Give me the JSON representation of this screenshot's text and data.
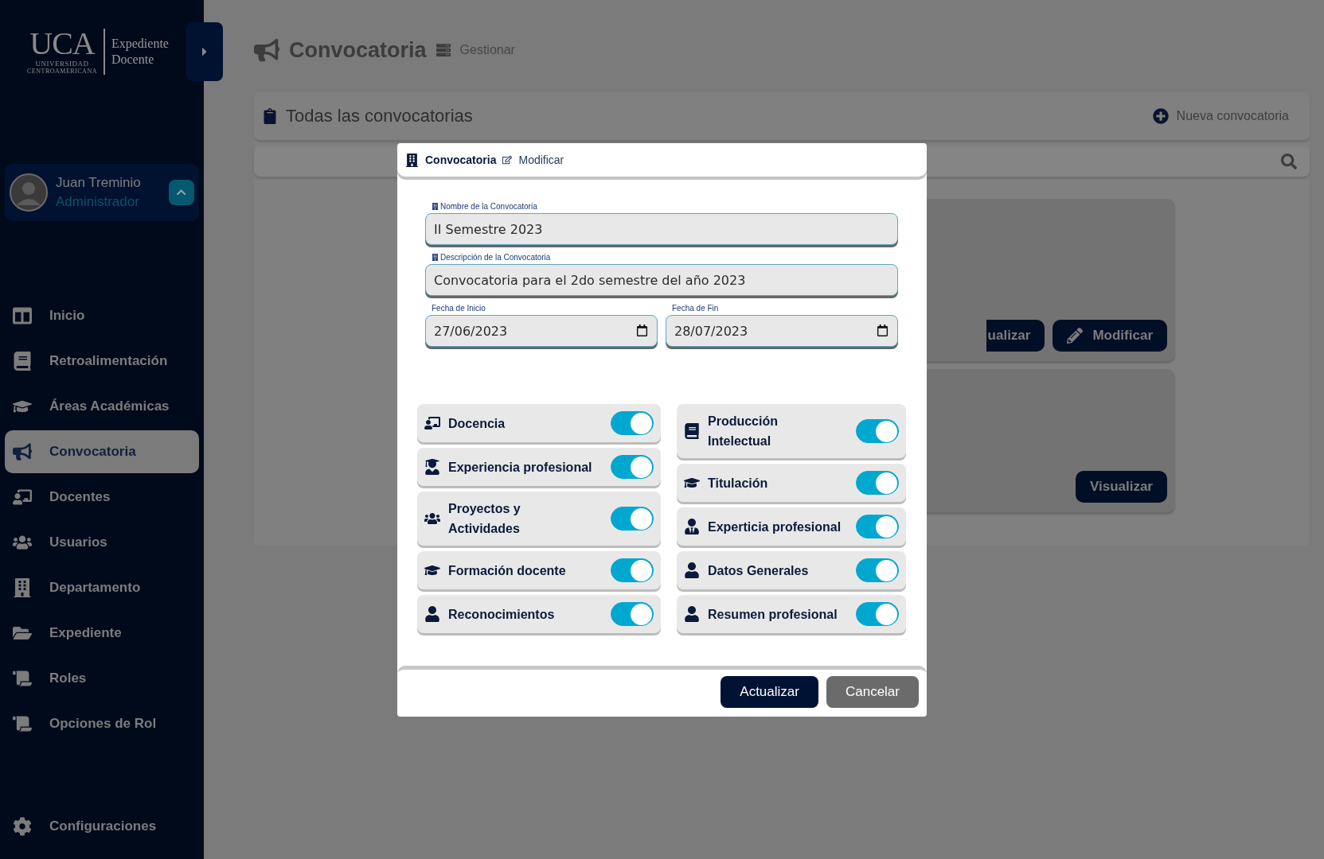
{
  "sidebar": {
    "logo": {
      "wordmark": "UCA",
      "line_1": "UNIVERSIDAD",
      "line_2": "CENTROAMERICANA",
      "product_1": "Expediente",
      "product_2": "Docente"
    },
    "user": {
      "name": "Juan Treminio",
      "role": "Administrador"
    },
    "items": [
      {
        "label": "Inicio",
        "selected": false
      },
      {
        "label": "Retroalimentación",
        "selected": false
      },
      {
        "label": "Áreas Académicas",
        "selected": false
      },
      {
        "label": "Convocatoria",
        "selected": true
      },
      {
        "label": "Docentes",
        "selected": false
      },
      {
        "label": "Usuarios",
        "selected": false
      },
      {
        "label": "Departamento",
        "selected": false
      },
      {
        "label": "Expediente",
        "selected": false
      },
      {
        "label": "Roles",
        "selected": false
      },
      {
        "label": "Opciones de Rol",
        "selected": false
      }
    ],
    "settings": "Configuraciones"
  },
  "page": {
    "title": "Convocatoria",
    "breadcrumb": "Gestionar"
  },
  "panel": {
    "title": "Todas las convocatorias",
    "action": "Nueva convocatoria",
    "cards": [
      {
        "buttons": [
          "ualizar",
          "Modificar"
        ]
      },
      {
        "buttons": [
          "Visualizar"
        ]
      }
    ]
  },
  "modal": {
    "title": "Convocatoria",
    "subtitle": "Modificar",
    "fields": [
      {
        "label": "Nombre de la Convocatoria",
        "value": "II Semestre 2023"
      },
      {
        "label": "Descripción de la Convocatoria",
        "value": "Convocatoria para el 2do semestre del año 2023"
      }
    ],
    "dates": [
      {
        "label": "Fecha de Inicio",
        "value": "27/06/2023"
      },
      {
        "label": "Fecha de Fin",
        "value": "28/07/2023"
      }
    ],
    "toggles_left": [
      {
        "label": "Docencia",
        "on": true,
        "kind": "single"
      },
      {
        "label": "Experiencia profesional",
        "on": true,
        "kind": "single"
      },
      {
        "label": "Proyectos y Actividades",
        "on": true,
        "kind": "double"
      },
      {
        "label": "Formación docente",
        "on": true,
        "kind": "single"
      },
      {
        "label": "Reconocimientos",
        "on": true,
        "kind": "single"
      }
    ],
    "toggles_right": [
      {
        "label": "Producción Intelectual",
        "on": true,
        "kind": "double"
      },
      {
        "label": "Titulación",
        "on": true,
        "kind": "single"
      },
      {
        "label": "Experticia profesional",
        "on": true,
        "kind": "single"
      },
      {
        "label": "Datos Generales",
        "on": true,
        "kind": "single"
      },
      {
        "label": "Resumen profesional",
        "on": true,
        "kind": "single"
      }
    ],
    "actions": [
      {
        "label": "Actualizar",
        "kind": "primary"
      },
      {
        "label": "Cancelar",
        "kind": "secondary"
      }
    ]
  }
}
